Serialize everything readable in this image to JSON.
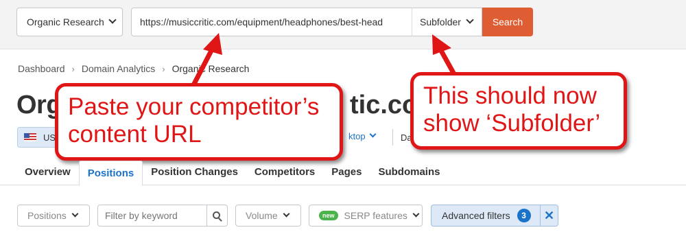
{
  "topbar": {
    "tool_select": "Organic Research",
    "url_value": "https://musiccritic.com/equipment/headphones/best-head",
    "scope_select": "Subfolder",
    "search_label": "Search"
  },
  "breadcrumb": [
    "Dashboard",
    "Domain Analytics",
    "Organic Research"
  ],
  "title": {
    "visible_start": "Org",
    "visible_end": "tic.co"
  },
  "filters_row": {
    "database": "US",
    "device": "ktop",
    "date_prefix": "Da"
  },
  "tabs": [
    "Overview",
    "Positions",
    "Position Changes",
    "Competitors",
    "Pages",
    "Subdomains"
  ],
  "active_tab": "Positions",
  "bottom_filters": {
    "positions": "Positions",
    "keyword_placeholder": "Filter by keyword",
    "volume": "Volume",
    "new_badge": "new",
    "serp_features": "SERP features",
    "advanced_filters": "Advanced filters",
    "advanced_count": "3"
  },
  "annotations": {
    "callout_1": [
      "Paste your competitor’s",
      "content URL"
    ],
    "callout_2": [
      "This should now",
      "show ‘Subfolder’"
    ],
    "color": "#e01616"
  },
  "colors": {
    "search_button": "#df5d33",
    "accent_blue": "#1a73c9",
    "new_badge": "#4bb34b"
  }
}
